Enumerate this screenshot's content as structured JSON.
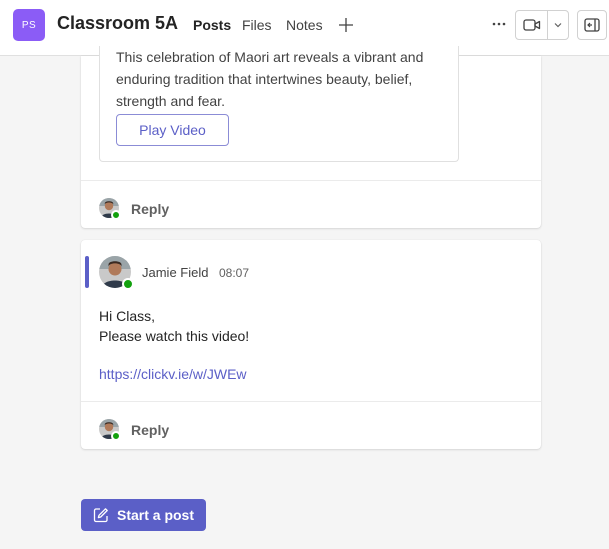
{
  "header": {
    "team_initials": "PS",
    "team_name": "Classroom 5A",
    "tabs": [
      {
        "label": "Posts",
        "active": true
      },
      {
        "label": "Files",
        "active": false
      },
      {
        "label": "Notes",
        "active": false
      }
    ],
    "add_tab_icon": "plus-icon",
    "more_icon": "ellipsis-icon",
    "meet_icon": "video-camera-icon",
    "meet_dropdown_icon": "chevron-down-icon",
    "panel_icon": "panel-collapse-icon"
  },
  "posts": [
    {
      "attachment": {
        "description": "This celebration of Maori art reveals a vibrant and enduring tradition that intertwines beauty, belief, strength and fear.",
        "button_label": "Play Video"
      },
      "reply_label": "Reply"
    },
    {
      "author": "Jamie Field",
      "time": "08:07",
      "body_lines": [
        "Hi Class,",
        "Please watch this video!"
      ],
      "link": "https://clickv.ie/w/JWEw",
      "reply_label": "Reply"
    }
  ],
  "compose": {
    "label": "Start a post",
    "icon": "compose-icon"
  },
  "colors": {
    "accent": "#5b5fc7",
    "team_avatar": "#8b5cf6",
    "presence_available": "#13a10e"
  }
}
